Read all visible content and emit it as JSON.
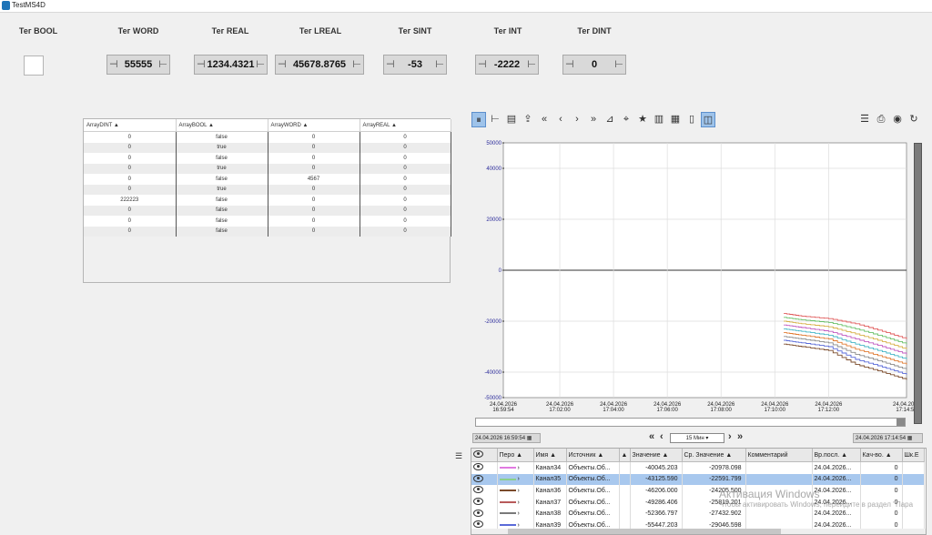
{
  "window": {
    "title": "TestMS4D"
  },
  "tags": [
    {
      "label": "Тег BOOL",
      "value": ""
    },
    {
      "label": "Тег WORD",
      "value": "55555"
    },
    {
      "label": "Тег REAL",
      "value": "1234.4321"
    },
    {
      "label": "Тег LREAL",
      "value": "45678.8765"
    },
    {
      "label": "Тег SINT",
      "value": "-53"
    },
    {
      "label": "Тег INT",
      "value": "-2222"
    },
    {
      "label": "Тег DINT",
      "value": "0"
    }
  ],
  "array_table": {
    "headers": [
      "ArrayDINT",
      "ArrayBOOL",
      "ArrayWORD",
      "ArrayREAL"
    ],
    "rows": [
      [
        "0",
        "false",
        "0",
        "0"
      ],
      [
        "0",
        "true",
        "0",
        "0"
      ],
      [
        "0",
        "false",
        "0",
        "0"
      ],
      [
        "0",
        "true",
        "0",
        "0"
      ],
      [
        "0",
        "false",
        "4567",
        "0"
      ],
      [
        "0",
        "true",
        "0",
        "0"
      ],
      [
        "222223",
        "false",
        "0",
        "0"
      ],
      [
        "0",
        "false",
        "0",
        "0"
      ],
      [
        "0",
        "false",
        "0",
        "0"
      ],
      [
        "0",
        "false",
        "0",
        "0"
      ]
    ]
  },
  "chart": {
    "y_ticks": [
      "50000",
      "40000",
      "20000",
      "0",
      "-20000",
      "-40000",
      "-50000"
    ],
    "x_ticks": [
      [
        "24.04.2026",
        "16:59:54"
      ],
      [
        "24.04.2026",
        "17:02:00"
      ],
      [
        "24.04.2026",
        "17:04:00"
      ],
      [
        "24.04.2026",
        "17:06:00"
      ],
      [
        "24.04.2026",
        "17:08:00"
      ],
      [
        "24.04.2026",
        "17:10:00"
      ],
      [
        "24.04.2026",
        "17:12:00"
      ],
      [
        "24.04.2026",
        "17:14:54"
      ]
    ]
  },
  "chart_data": {
    "type": "line",
    "ylim": [
      -50000,
      50000
    ],
    "x": [
      "17:10:20",
      "17:11:00",
      "17:12:00",
      "17:13:00",
      "17:14:00",
      "17:14:54"
    ],
    "series": [
      {
        "color": "#e05a5a",
        "values": [
          -17000,
          -18000,
          -19000,
          -21000,
          -24000,
          -27000
        ]
      },
      {
        "color": "#69c069",
        "values": [
          -18500,
          -19500,
          -20500,
          -23000,
          -26000,
          -29000
        ]
      },
      {
        "color": "#d8b14a",
        "values": [
          -20000,
          -21000,
          -22200,
          -25000,
          -28000,
          -31000
        ]
      },
      {
        "color": "#c05ac0",
        "values": [
          -21500,
          -22500,
          -24000,
          -27000,
          -30000,
          -33000
        ]
      },
      {
        "color": "#46b6c6",
        "values": [
          -23000,
          -24000,
          -25500,
          -29000,
          -32000,
          -35000
        ]
      },
      {
        "color": "#e07a30",
        "values": [
          -24500,
          -25500,
          -27000,
          -31000,
          -34000,
          -37000
        ]
      },
      {
        "color": "#8a8a8a",
        "values": [
          -26000,
          -27000,
          -28500,
          -33000,
          -36000,
          -39000
        ]
      },
      {
        "color": "#5a6ad8",
        "values": [
          -27500,
          -28500,
          -30000,
          -35000,
          -38000,
          -41000
        ]
      },
      {
        "color": "#7a4a2a",
        "values": [
          -29000,
          -30000,
          -31500,
          -37000,
          -40000,
          -43000
        ]
      }
    ]
  },
  "navigation": {
    "start": "24.04.2026 16:59:54",
    "end": "24.04.2026 17:14:54",
    "period": "15 Мин"
  },
  "legend": {
    "headers": [
      "",
      "Перо",
      "Имя",
      "Источник",
      "",
      "Значение",
      "Ср. Значение",
      "Комментарий",
      "Вр.посл.",
      "Кач-во.",
      "Шк.Е"
    ],
    "rows": [
      {
        "pen": "#e07ae0",
        "name": "Канал34",
        "source": "Объекты.Об...",
        "value": "-40045.203",
        "avg": "-20978.098",
        "comment": "",
        "time": "24.04.2026...",
        "quality": "0",
        "selected": false
      },
      {
        "pen": "#8cd08c",
        "name": "Канал35",
        "source": "Объекты.Об...",
        "value": "-43125.590",
        "avg": "-22591.799",
        "comment": "",
        "time": "24.04.2026...",
        "quality": "0",
        "selected": true
      },
      {
        "pen": "#7a4a2a",
        "name": "Канал36",
        "source": "Объекты.Об...",
        "value": "-46206.000",
        "avg": "-24205.500",
        "comment": "",
        "time": "24.04.2026...",
        "quality": "0",
        "selected": false
      },
      {
        "pen": "#b85a5a",
        "name": "Канал37",
        "source": "Объекты.Об...",
        "value": "-49286.406",
        "avg": "-25819.201",
        "comment": "",
        "time": "24.04.2026...",
        "quality": "0",
        "selected": false
      },
      {
        "pen": "#7a7a7a",
        "name": "Канал38",
        "source": "Объекты.Об...",
        "value": "-52366.797",
        "avg": "-27432.902",
        "comment": "",
        "time": "24.04.2026...",
        "quality": "0",
        "selected": false
      },
      {
        "pen": "#5a6ad8",
        "name": "Канал39",
        "source": "Объекты.Об...",
        "value": "-55447.203",
        "avg": "-29046.598",
        "comment": "",
        "time": "24.04.2026...",
        "quality": "0",
        "selected": false
      }
    ]
  },
  "watermark": {
    "title": "Активация Windows",
    "text": "Чтобы активировать Windows, перейдите в раздел \"Пара"
  },
  "icons": [
    "pause-icon",
    "tree-icon",
    "table-icon",
    "export-icon",
    "first-icon",
    "prev-icon",
    "next-icon",
    "last-icon",
    "zoom-icon",
    "cursor-icon",
    "star-icon",
    "scale-icon",
    "grid-icon",
    "split-icon",
    "layout-icon",
    "list-icon",
    "print-icon",
    "camera-icon",
    "refresh-icon"
  ]
}
